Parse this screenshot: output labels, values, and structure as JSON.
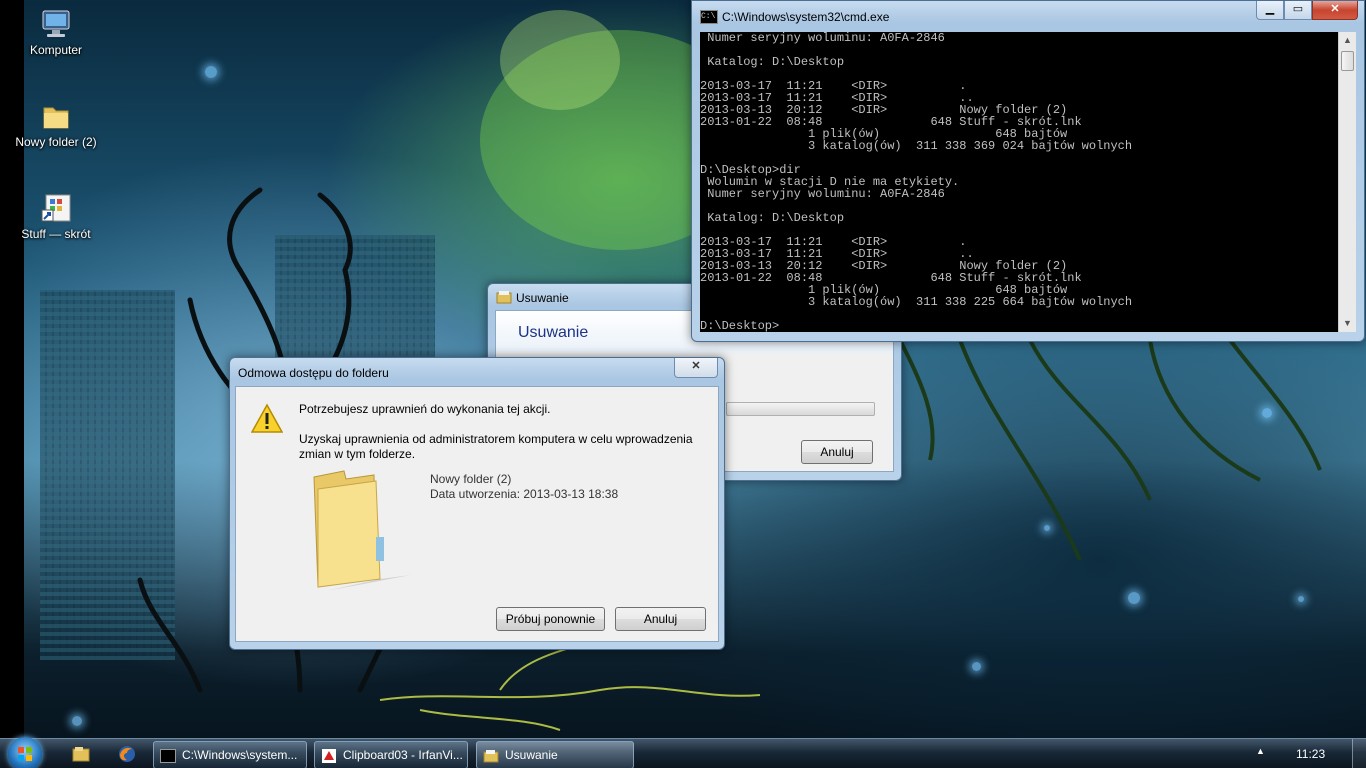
{
  "desktop": {
    "icons": [
      {
        "label": "Komputer",
        "icon": "computer-icon"
      },
      {
        "label": "Nowy folder (2)",
        "icon": "folder-icon"
      },
      {
        "label": "Stuff — skrót",
        "icon": "shortcut-icon"
      }
    ]
  },
  "cmd": {
    "title": "C:\\Windows\\system32\\cmd.exe",
    "lines": [
      " Numer seryjny woluminu: A0FA-2846",
      "",
      " Katalog: D:\\Desktop",
      "",
      "2013-03-17  11:21    <DIR>          .",
      "2013-03-17  11:21    <DIR>          ..",
      "2013-03-13  20:12    <DIR>          Nowy folder (2)",
      "2013-01-22  08:48               648 Stuff - skrót.lnk",
      "               1 plik(ów)                648 bajtów",
      "               3 katalog(ów)  311 338 369 024 bajtów wolnych",
      "",
      "D:\\Desktop>dir",
      " Wolumin w stacji D nie ma etykiety.",
      " Numer seryjny woluminu: A0FA-2846",
      "",
      " Katalog: D:\\Desktop",
      "",
      "2013-03-17  11:21    <DIR>          .",
      "2013-03-17  11:21    <DIR>          ..",
      "2013-03-13  20:12    <DIR>          Nowy folder (2)",
      "2013-01-22  08:48               648 Stuff - skrót.lnk",
      "               1 plik(ów)                648 bajtów",
      "               3 katalog(ów)  311 338 225 664 bajtów wolnych",
      "",
      "D:\\Desktop>"
    ]
  },
  "delete_dialog": {
    "title": "Usuwanie",
    "heading": "Usuwanie",
    "cancel_label": "Anuluj",
    "progress_fraction": 0.0
  },
  "access_dialog": {
    "title": "Odmowa dostępu do folderu",
    "message": "Potrzebujesz uprawnień do wykonania tej akcji.",
    "detail_line1": "Uzyskaj uprawnienia od administratorem komputera w celu wprowadzenia",
    "detail_line2": "zmian w tym folderze.",
    "folder_name": "Nowy folder (2)",
    "folder_date": "Data utworzenia: 2013-03-13 18:38",
    "retry_label": "Próbuj ponownie",
    "cancel_label": "Anuluj"
  },
  "taskbar": {
    "items": [
      {
        "label": "C:\\Windows\\system...",
        "icon": "cmd-icon"
      },
      {
        "label": "Clipboard03 - IrfanVi...",
        "icon": "irfanview-icon"
      },
      {
        "label": "Usuwanie",
        "icon": "explorer-folder-icon"
      }
    ],
    "clock": "11:23",
    "tray_arrow": "▲"
  }
}
